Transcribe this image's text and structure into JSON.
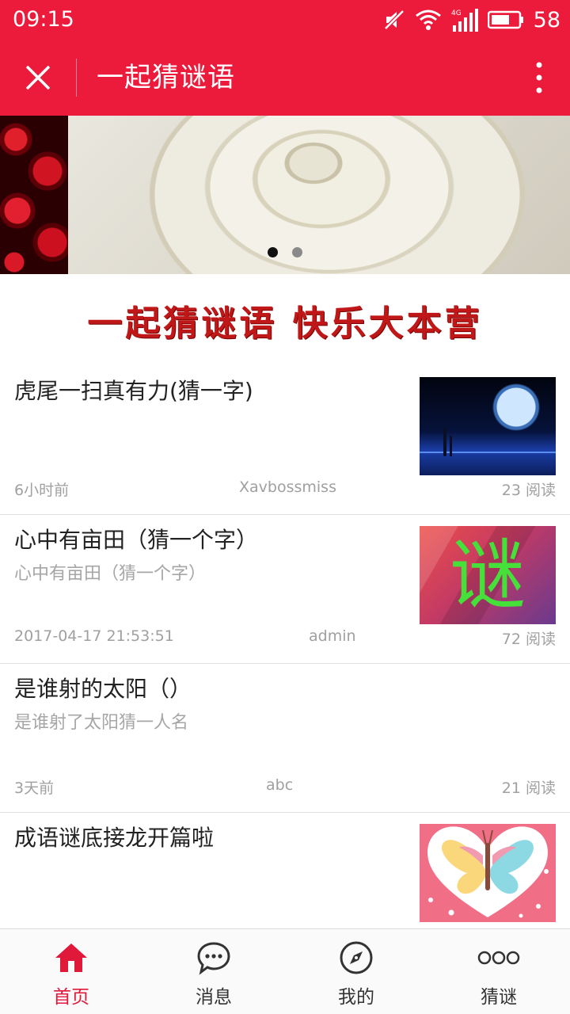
{
  "status_bar": {
    "time": "09:15",
    "battery_level": "58",
    "network": "4G",
    "icons": [
      "mute-icon",
      "wifi-icon",
      "signal-icon",
      "battery-icon"
    ]
  },
  "header": {
    "title": "一起猜谜语",
    "close_icon": "close-icon",
    "more_icon": "more-vertical-icon"
  },
  "banner": {
    "slide_count": 2,
    "active_index": 0
  },
  "slogan": "一起猜谜语 快乐大本营",
  "feed": [
    {
      "title": "虎尾一扫真有力(猜一字)",
      "desc": "",
      "time": "6小时前",
      "author": "Xavbossmiss",
      "reads": "23 阅读",
      "thumb": "moon-night-image"
    },
    {
      "title": "心中有亩田（猜一个字）",
      "desc": "心中有亩田（猜一个字）",
      "time": "2017-04-17 21:53:51",
      "author": "admin",
      "reads": "72 阅读",
      "thumb": "riddle-character-image",
      "thumb_text": "谜"
    },
    {
      "title": "是谁射的太阳（）",
      "desc": "是谁射了太阳猜一人名",
      "time": "3天前",
      "author": "abc",
      "reads": "21 阅读",
      "thumb": ""
    },
    {
      "title": "成语谜底接龙开篇啦",
      "desc": "",
      "time": "",
      "author": "",
      "reads": "",
      "thumb": "butterfly-heart-image"
    }
  ],
  "tabs": [
    {
      "label": "首页",
      "icon": "home-icon",
      "active": true
    },
    {
      "label": "消息",
      "icon": "chat-bubble-icon",
      "active": false
    },
    {
      "label": "我的",
      "icon": "compass-icon",
      "active": false
    },
    {
      "label": "猜谜",
      "icon": "dots-icon",
      "active": false
    }
  ],
  "colors": {
    "brand_red": "#ec1a3b",
    "active_tab": "#e0183a",
    "meta_gray": "#a0a0a0"
  }
}
